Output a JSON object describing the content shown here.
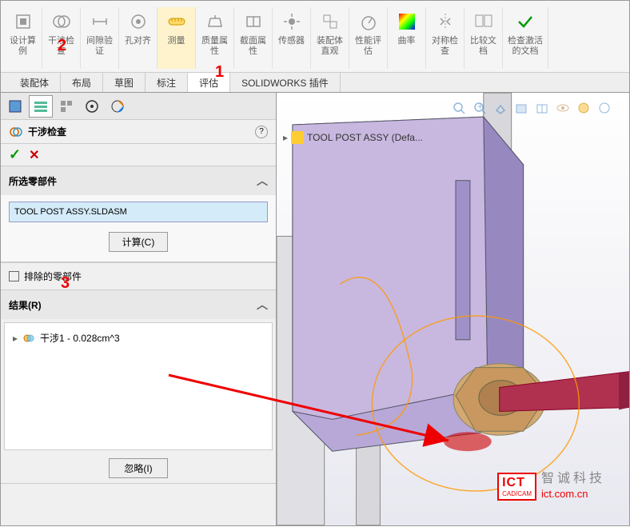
{
  "toolbar": {
    "items": [
      {
        "label": "设计算\n例",
        "icon": "design"
      },
      {
        "label": "干涉检\n查",
        "icon": "interference"
      },
      {
        "label": "间隙验\n证",
        "icon": "clearance"
      },
      {
        "label": "孔对齐",
        "icon": "hole"
      },
      {
        "label": "测量",
        "icon": "measure",
        "highlighted": true
      },
      {
        "label": "质量属\n性",
        "icon": "mass"
      },
      {
        "label": "截面属\n性",
        "icon": "section"
      },
      {
        "label": "传感器",
        "icon": "sensor"
      },
      {
        "label": "装配体\n直观",
        "icon": "assembly"
      },
      {
        "label": "性能评\n估",
        "icon": "performance"
      },
      {
        "label": "曲率",
        "icon": "curvature",
        "colored": true
      },
      {
        "label": "对称检\n查",
        "icon": "symmetry"
      },
      {
        "label": "比较文\n档",
        "icon": "compare"
      },
      {
        "label": "检查激活\n的文档",
        "icon": "check"
      }
    ]
  },
  "tabs": {
    "items": [
      "装配体",
      "布局",
      "草图",
      "标注",
      "评估",
      "SOLIDWORKS 插件"
    ],
    "active": "评估"
  },
  "panel": {
    "title": "干涉检查",
    "sections": {
      "selected": {
        "title": "所选零部件",
        "value": "TOOL POST ASSY.SLDASM",
        "calc_button": "计算(C)"
      },
      "excluded": {
        "title": "排除的零部件"
      },
      "results": {
        "title": "结果(R)",
        "items": [
          {
            "label": "干涉1 - 0.028cm^3"
          }
        ],
        "ignore_button": "忽略(I)"
      }
    }
  },
  "viewport": {
    "breadcrumb": "TOOL POST ASSY (Defa..."
  },
  "annotations": {
    "a1": "1",
    "a2": "2",
    "a3": "3"
  },
  "watermark": {
    "logo_top": "ICT",
    "logo_bot": "CAD/CAM",
    "text_cn": "智诚科技",
    "text_en": "ict.com.cn"
  }
}
